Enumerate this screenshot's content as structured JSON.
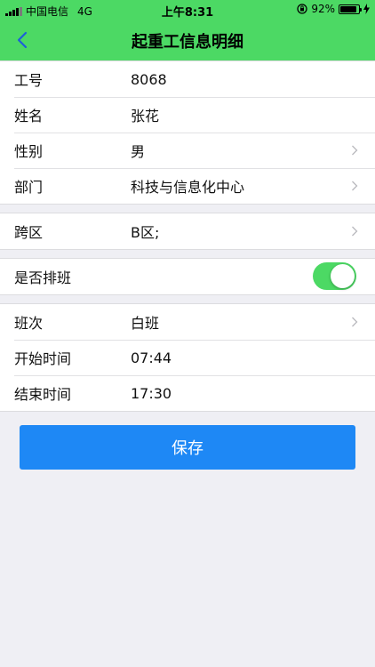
{
  "status_bar": {
    "carrier": "中国电信",
    "network": "4G",
    "time": "上午8:31",
    "battery_percent": "92%",
    "battery_level": 0.92
  },
  "nav": {
    "title": "起重工信息明细",
    "back_icon": "chevron-left-icon"
  },
  "colors": {
    "nav_background": "#4cd964",
    "toggle_on": "#4cd964",
    "save_button": "#1e88f5",
    "page_background": "#efeff4"
  },
  "basic_info": [
    {
      "label": "工号",
      "value": "8068"
    },
    {
      "label": "姓名",
      "value": "张花"
    },
    {
      "label": "性别",
      "value": "男"
    },
    {
      "label": "部门",
      "value": "科技与信息化中心"
    }
  ],
  "cross_area": {
    "label": "跨区",
    "value": "B区;"
  },
  "scheduling": {
    "label": "是否排班",
    "enabled": true
  },
  "shift_info": [
    {
      "label": "班次",
      "value": "白班"
    },
    {
      "label": "开始时间",
      "value": "07:44"
    },
    {
      "label": "结束时间",
      "value": "17:30"
    }
  ],
  "save_button": {
    "label": "保存"
  }
}
